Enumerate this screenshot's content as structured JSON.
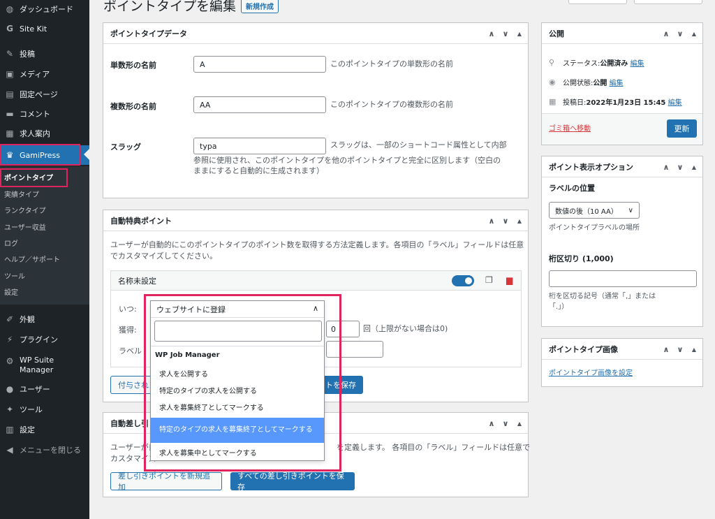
{
  "sidebar": {
    "items": [
      {
        "label": "ダッシュボード",
        "icon": "dashboard-icon",
        "glyph": "◍"
      },
      {
        "label": "Site Kit",
        "icon": "sitekit-icon",
        "glyph": "G"
      },
      {
        "label": "投稿",
        "icon": "pin-icon",
        "glyph": "✎"
      },
      {
        "label": "メディア",
        "icon": "media-icon",
        "glyph": "▣"
      },
      {
        "label": "固定ページ",
        "icon": "page-icon",
        "glyph": "▤"
      },
      {
        "label": "コメント",
        "icon": "comment-icon",
        "glyph": "▬"
      },
      {
        "label": "求人案内",
        "icon": "briefcase-icon",
        "glyph": "▦"
      },
      {
        "label": "GamiPress",
        "icon": "crown-icon",
        "glyph": "♛"
      },
      {
        "label": "外観",
        "icon": "brush-icon",
        "glyph": "✐"
      },
      {
        "label": "プラグイン",
        "icon": "plugin-icon",
        "glyph": "⚡"
      },
      {
        "label": "WP Suite Manager",
        "icon": "gear-icon",
        "glyph": "⚙"
      },
      {
        "label": "ユーザー",
        "icon": "user-icon",
        "glyph": "●"
      },
      {
        "label": "ツール",
        "icon": "wrench-icon",
        "glyph": "✦"
      },
      {
        "label": "設定",
        "icon": "settings-icon",
        "glyph": "▥"
      },
      {
        "label": "メニューを閉じる",
        "icon": "collapse-icon",
        "glyph": "◀"
      }
    ],
    "submenu": [
      "ポイントタイプ",
      "実績タイプ",
      "ランクタイプ",
      "ユーザー収益",
      "ログ",
      "ヘルプ／サポート",
      "ツール",
      "設定"
    ]
  },
  "header": {
    "title": "ポイントタイプを編集",
    "new_label": "新規作成"
  },
  "point_type_data": {
    "title": "ポイントタイプデータ",
    "singular_label": "単数形の名前",
    "singular_value": "A",
    "singular_desc": "このポイントタイプの単数形の名前",
    "plural_label": "複数形の名前",
    "plural_value": "AA",
    "plural_desc": "このポイントタイプの複数形の名前",
    "slug_label": "スラッグ",
    "slug_value": "typa",
    "slug_desc_1": "スラッグは、一部のショートコード属性として内部",
    "slug_desc_2": "参照に使用され、このポイントタイプを他のポイントタイプと完全に区別します（空白の",
    "slug_desc_3": "ままにすると自動的に生成されます）"
  },
  "auto_award": {
    "title": "自動特典ポイント",
    "desc_1": "ユーザーが自動的にこのポイントタイプのポイント数を取得する方法定義します。各項目の「ラベル」フィールドは任意",
    "desc_2": "でカスタマイズしてください。",
    "rule_title": "名称未設定",
    "when_label": "いつ:",
    "earn_label": "獲得:",
    "label_label": "ラベル",
    "times_value": "0",
    "times_suffix": "回（上限がない場合は0)",
    "add_label": "付与され",
    "save_label": "ントを保存"
  },
  "dropdown": {
    "selected": "ウェブサイトに登録",
    "group": "WP Job Manager",
    "options": [
      "求人を公開する",
      "特定のタイプの求人を公開する",
      "求人を募集終了としてマークする",
      "特定のタイプの求人を募集終了としてマークする",
      "求人を募集中としてマークする"
    ],
    "highlighted_index": 3
  },
  "auto_deduct": {
    "title": "自動差し引",
    "desc_1_left": "ユーザーが自",
    "desc_1_right": "を定義します。 各項目の「ラベル」フィールドは任意で",
    "desc_2_left": "カスタマイズ",
    "add_label": "差し引きポイントを新規追加",
    "save_label": "すべての差し引きポイントを保存"
  },
  "publish": {
    "title": "公開",
    "status_label": "ステータス: ",
    "status_value": "公開済み",
    "visibility_label": "公開状態: ",
    "visibility_value": "公開",
    "date_label": "投稿日: ",
    "date_value": "2022年1月23日 15:45",
    "edit_label": "編集",
    "trash_label": "ゴミ箱へ移動",
    "update_label": "更新"
  },
  "display_options": {
    "title": "ポイント表示オプション",
    "label_position_title": "ラベルの位置",
    "label_position_value": "数値の後（10 AA）",
    "label_position_desc": "ポイントタイプラベルの場所",
    "separator_title": "桁区切り (1,000)",
    "separator_desc_1": "桁を区切る記号（通常「,」または",
    "separator_desc_2": "「.」）"
  },
  "image": {
    "title": "ポイントタイプ画像",
    "set_label": "ポイントタイプ画像を設定"
  },
  "colors": {
    "accent": "#2271b1",
    "sidebar": "#1d2327",
    "highlight": "#e0245e",
    "option_highlight": "#5897fb",
    "delete": "#d63638"
  }
}
